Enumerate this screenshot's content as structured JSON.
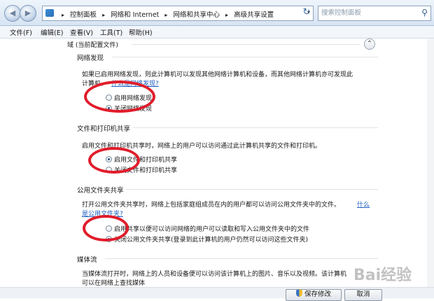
{
  "address_bar": {
    "crumbs": [
      "控制面板",
      "网络和 Internet",
      "网络和共享中心",
      "高级共享设置"
    ],
    "search_placeholder": "搜索控制面板"
  },
  "menu": {
    "file": "文件(F)",
    "edit": "编辑(E)",
    "view": "查看(V)",
    "tools": "工具(T)",
    "help": "帮助(H)"
  },
  "profile": {
    "header": "域 (当前配置文件)"
  },
  "network_discovery": {
    "title": "网络发现",
    "desc_line1": "如果已启用网络发现，则此计算机可以发现其他网络计算机和设备，而其他网络计算机亦可发现此",
    "desc_line2_prefix": "计算机。",
    "link": "什么是网络发现?",
    "options": [
      "启用网络发现",
      "关闭网络发现"
    ],
    "selected": 1
  },
  "file_printer_sharing": {
    "title": "文件和打印机共享",
    "desc": "启用文件和打印机共享时，网络上的用户可以访问通过此计算机共享的文件和打印机。",
    "options": [
      "启用文件和打印机共享",
      "关闭文件和打印机共享"
    ],
    "selected": 0
  },
  "public_folder_sharing": {
    "title": "公用文件夹共享",
    "desc_line1": "打开公用文件夹共享时，网络上包括家庭组成员在内的用户都可以访问公用文件夹中的文件。",
    "link_part1": "什么",
    "link_part2": "是公用文件夹?",
    "options": [
      "启用共享以便可以访问网络的用户可以读取和写入公用文件夹中的文件",
      "关闭公用文件夹共享(登录到此计算机的用户仍然可以访问这些文件夹)"
    ],
    "selected": 1
  },
  "media_streaming": {
    "title": "媒体流",
    "desc_line1": "当媒体流打开时，网络上的人员和设备便可以访问该计算机上的图片、音乐以及视频。该计算机",
    "desc_line2": "可以在网络上查找媒体"
  },
  "footer": {
    "save": "保存修改",
    "cancel": "取消"
  },
  "watermark": "Bai经验",
  "annotation_color": "#e11c2a"
}
